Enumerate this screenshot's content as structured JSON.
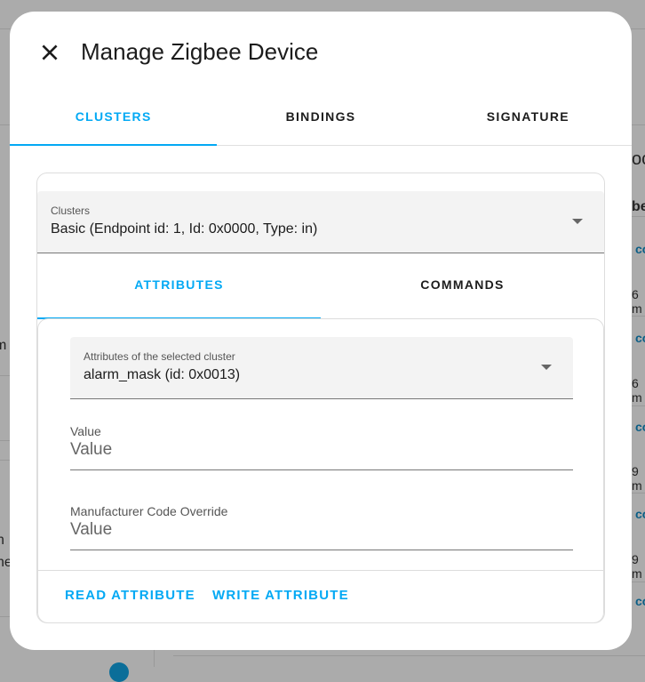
{
  "dialog": {
    "title": "Manage Zigbee Device"
  },
  "tabs": [
    {
      "label": "CLUSTERS",
      "active": true
    },
    {
      "label": "BINDINGS"
    },
    {
      "label": "SIGNATURE"
    }
  ],
  "clusters_select": {
    "label": "Clusters",
    "value": "Basic (Endpoint id: 1, Id: 0x0000, Type: in)"
  },
  "subtabs": [
    {
      "label": "ATTRIBUTES",
      "active": true
    },
    {
      "label": "COMMANDS"
    }
  ],
  "attributes_select": {
    "label": "Attributes of the selected cluster",
    "value": "alarm_mask (id: 0x0013)"
  },
  "value_field": {
    "label": "Value",
    "placeholder": "Value"
  },
  "manufacturer_field": {
    "label": "Manufacturer Code Override",
    "placeholder": "Value"
  },
  "actions": {
    "read": "READ ATTRIBUTE",
    "write": "WRITE ATTRIBUTE"
  },
  "background": {
    "right_fragments": [
      "oc",
      "be"
    ],
    "right_links": [
      "co",
      "co",
      "co",
      "co",
      "co"
    ],
    "right_times": [
      "6 m",
      "6 m",
      "9 m",
      "9 m"
    ],
    "left_fragments": [
      "m",
      "n",
      "ne"
    ]
  },
  "colors": {
    "accent": "#03a9f4",
    "overlay": "#ababab"
  }
}
